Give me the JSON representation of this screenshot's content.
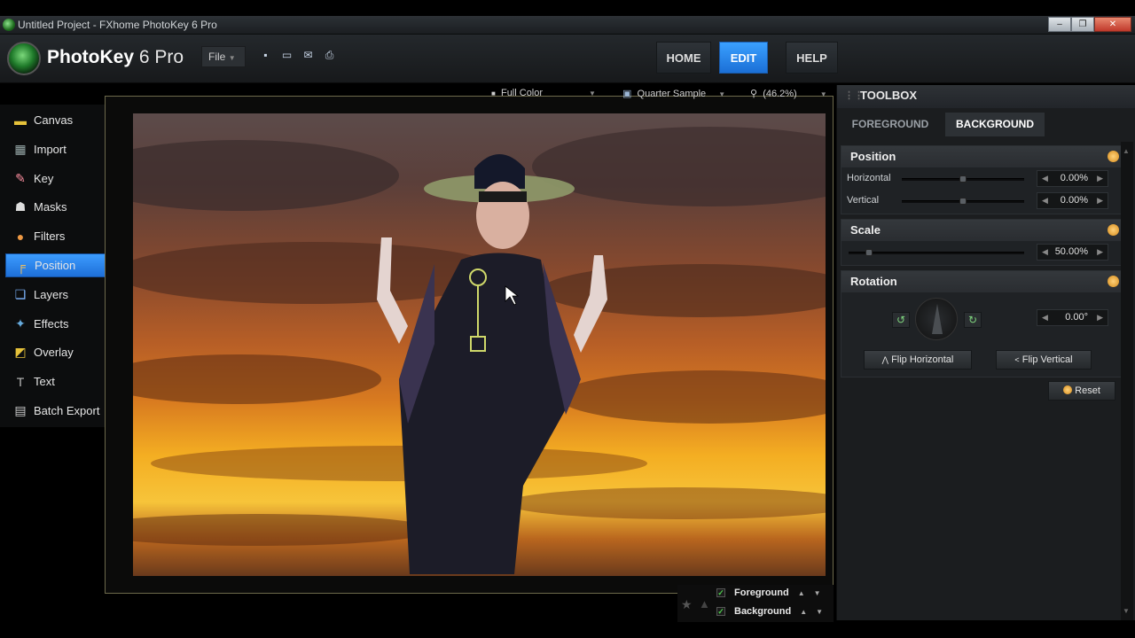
{
  "window": {
    "title": "Untitled Project - FXhome PhotoKey 6 Pro",
    "buttons": [
      "–",
      "❐",
      "✕"
    ]
  },
  "app": {
    "name_bold": "PhotoKey",
    "name_rest": " 6 Pro",
    "file_menu": "File"
  },
  "nav": {
    "home": "HOME",
    "edit": "EDIT",
    "help": "HELP",
    "active": "EDIT"
  },
  "sidebar": {
    "active": "Position",
    "items": [
      {
        "label": "Canvas",
        "icon": "canvas-icon"
      },
      {
        "label": "Import",
        "icon": "import-icon"
      },
      {
        "label": "Key",
        "icon": "key-icon"
      },
      {
        "label": "Masks",
        "icon": "masks-icon"
      },
      {
        "label": "Filters",
        "icon": "filters-icon"
      },
      {
        "label": "Position",
        "icon": "position-icon"
      },
      {
        "label": "Layers",
        "icon": "layers-icon"
      },
      {
        "label": "Effects",
        "icon": "effects-icon"
      },
      {
        "label": "Overlay",
        "icon": "overlay-icon"
      },
      {
        "label": "Text",
        "icon": "text-icon"
      },
      {
        "label": "Batch Export",
        "icon": "batch-export-icon"
      }
    ]
  },
  "viewbar": {
    "color_mode": "Full Color",
    "sample": "Quarter Sample",
    "zoom": "(46.2%)"
  },
  "toolbox": {
    "title": "TOOLBOX",
    "tabs": {
      "foreground": "FOREGROUND",
      "background": "BACKGROUND",
      "active": "BACKGROUND"
    },
    "position": {
      "title": "Position",
      "horizontal_label": "Horizontal",
      "horizontal_value": "0.00%",
      "horizontal_slider": 0.5,
      "vertical_label": "Vertical",
      "vertical_value": "0.00%",
      "vertical_slider": 0.5
    },
    "scale": {
      "title": "Scale",
      "value": "50.00%",
      "slider": 0.1
    },
    "rotation": {
      "title": "Rotation",
      "value": "0.00°",
      "flip_h": "Flip Horizontal",
      "flip_v": "Flip Vertical"
    },
    "reset": "Reset"
  },
  "layers": {
    "foreground": "Foreground",
    "background": "Background"
  }
}
